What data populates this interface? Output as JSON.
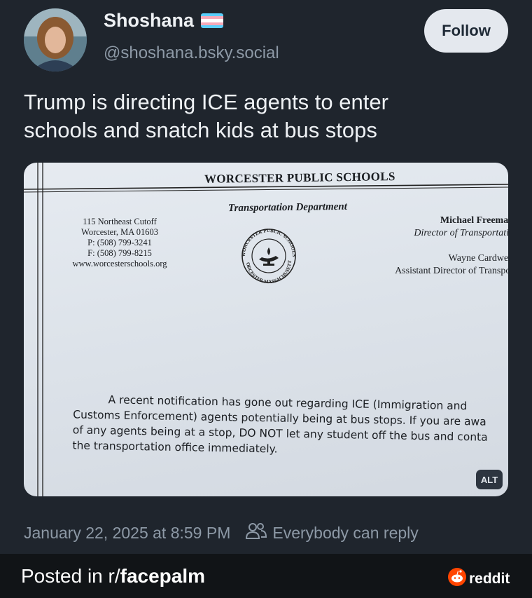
{
  "post": {
    "display_name": "Shoshana",
    "handle": "@shoshana.bsky.social",
    "follow_label": "Follow",
    "text_line1": "Trump is directing ICE agents to enter",
    "text_line2": "schools and snatch kids at bus stops",
    "timestamp": "January 22, 2025 at 8:59 PM",
    "reply_setting": "Everybody can reply"
  },
  "document": {
    "title": "WORCESTER PUBLIC SCHOOLS",
    "department": "Transportation Department",
    "address": [
      "115 Northeast Cutoff",
      "Worcester, MA 01603",
      "P: (508) 799-3241",
      "F: (508) 799-8215",
      "www.worcesterschools.org"
    ],
    "director_name": "Michael Freeman",
    "director_title": "Director of Transportatio",
    "assistant_name": "Wayne Cardwell",
    "assistant_title": "Assistant Director of Transpor",
    "seal_top": "WORCESTER PUBLIC SCHOOLS",
    "seal_bottom": "WORCESTER MASSACHUSETTS",
    "notice_lines": [
      "A recent notification has gone out regarding ICE (Immigration and",
      "Customs Enforcement) agents potentially being at bus stops. If you are awa",
      "of any agents being at a stop, DO NOT let any student off the bus and conta",
      "the transportation office immediately."
    ],
    "alt_label": "ALT"
  },
  "footer": {
    "posted_in": "Posted in r/",
    "subreddit": "facepalm",
    "brand": "reddit"
  },
  "icons": {
    "flag": "trans-flag-icon",
    "reply": "people-icon",
    "brand": "reddit-snoo-icon"
  },
  "colors": {
    "background": "#1f252d",
    "footer_bg": "#111417",
    "muted_text": "#8d99a6",
    "reddit_orange": "#ff4500"
  }
}
